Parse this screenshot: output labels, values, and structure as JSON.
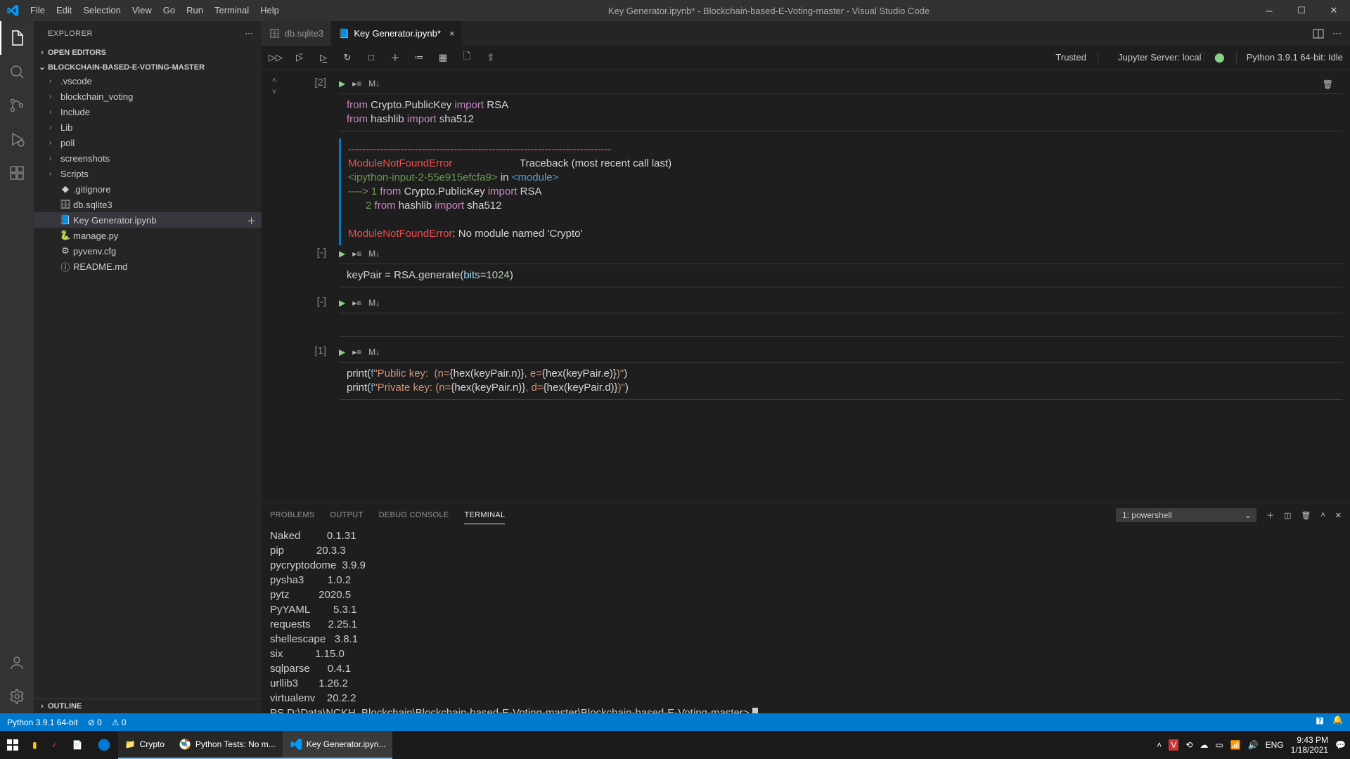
{
  "title": "Key Generator.ipynb* - Blockchain-based-E-Voting-master - Visual Studio Code",
  "menu": [
    "File",
    "Edit",
    "Selection",
    "View",
    "Go",
    "Run",
    "Terminal",
    "Help"
  ],
  "explorer": {
    "header": "EXPLORER",
    "open_editors": "OPEN EDITORS",
    "project": "BLOCKCHAIN-BASED-E-VOTING-MASTER",
    "folders": [
      ".vscode",
      "blockchain_voting",
      "Include",
      "Lib",
      "poll",
      "screenshots",
      "Scripts"
    ],
    "files": [
      {
        "icon": "◆",
        "label": ".gitignore"
      },
      {
        "icon": "🗄",
        "label": "db.sqlite3"
      },
      {
        "icon": "📘",
        "label": "Key Generator.ipynb",
        "active": true
      },
      {
        "icon": "🐍",
        "label": "manage.py"
      },
      {
        "icon": "⚙",
        "label": "pyvenv.cfg"
      },
      {
        "icon": "ⓘ",
        "label": "README.md"
      }
    ],
    "outline": "OUTLINE"
  },
  "tabs": [
    {
      "icon": "🗄",
      "label": "db.sqlite3",
      "active": false
    },
    {
      "icon": "📘",
      "label": "Key Generator.ipynb*",
      "active": true
    }
  ],
  "nb_status": {
    "trusted": "Trusted",
    "server": "Jupyter Server: local",
    "kernel": "Python 3.9.1 64-bit: Idle"
  },
  "cells": [
    {
      "exec": "[2]",
      "code_html": "<span class='kw'>from</span> Crypto.PublicKey <span class='kw'>import</span> RSA\n<span class='kw'>from</span> hashlib <span class='kw'>import</span> sha512"
    },
    {
      "exec": "[-]",
      "code_html": "keyPair = RSA.generate(<span class='par'>bits</span>=<span class='num'>1024</span>)"
    },
    {
      "exec": "[-]",
      "code_html": " "
    },
    {
      "exec": "[1]",
      "code_html": "print(<span class='ln'>f</span><span class='str'>\"Public key:  (n=</span>{hex(keyPair.n)}<span class='str'>, e=</span>{hex(keyPair.e)}<span class='str'>)\"</span>)\nprint(<span class='ln'>f</span><span class='str'>\"Private key: (n=</span>{hex(keyPair.n)}<span class='str'>, d=</span>{hex(keyPair.d)}<span class='str'>)\"</span>)"
    }
  ],
  "error_output": "<span class='err'>---------------------------------------------------------------------------</span>\n<span class='err'>ModuleNotFoundError</span>                       Traceback (most recent call last)\n<span class='grn'>&lt;ipython-input-2-55e915efcfa9&gt;</span> in <span class='ln'>&lt;module&gt;</span>\n<span class='grn'>----&gt; 1</span> <span class='kw'>from</span> Crypto.PublicKey <span class='kw'>import</span> RSA\n      <span class='grn'>2</span> <span class='kw'>from</span> hashlib <span class='kw'>import</span> sha512\n\n<span class='err'>ModuleNotFoundError</span>: No module named 'Crypto'",
  "panel": {
    "tabs": [
      "PROBLEMS",
      "OUTPUT",
      "DEBUG CONSOLE",
      "TERMINAL"
    ],
    "active": "TERMINAL",
    "select": "1: powershell",
    "body": "Naked         0.1.31\npip           20.3.3\npycryptodome  3.9.9\npysha3        1.0.2\npytz          2020.5\nPyYAML        5.3.1\nrequests      2.25.1\nshellescape   3.8.1\nsix           1.15.0\nsqlparse      0.4.1\nurllib3       1.26.2\nvirtualenv    20.2.2\nPS D:\\Data\\NCKH_Blockchain\\Blockchain-based-E-Voting-master\\Blockchain-based-E-Voting-master> "
  },
  "status": {
    "python": "Python 3.9.1 64-bit",
    "errors": "⊘ 0",
    "warnings": "⚠ 0"
  },
  "taskbar": {
    "folder": "Crypto",
    "chrome": "Python Tests: No m...",
    "vscode": "Key Generator.ipyn...",
    "lang": "ENG",
    "time": "9:43 PM",
    "date": "1/18/2021"
  }
}
